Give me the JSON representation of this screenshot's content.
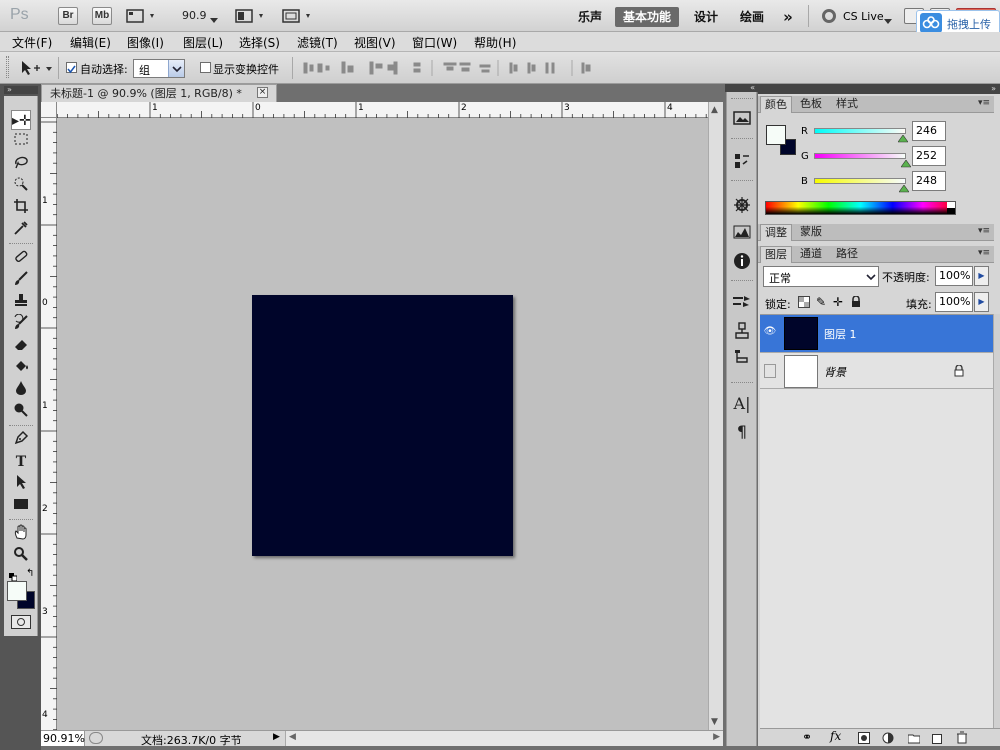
{
  "app": {
    "logo": "Ps",
    "bridge_btn": "Br",
    "minibridge_btn": "Mb",
    "zoom_value": "90.9",
    "workspaces": [
      "乐声",
      "基本功能",
      "设计",
      "绘画"
    ],
    "more": "»",
    "cs_live": "CS Live",
    "overlay_label": "拖拽上传"
  },
  "menubar": [
    "文件(F)",
    "编辑(E)",
    "图像(I)",
    "图层(L)",
    "选择(S)",
    "滤镜(T)",
    "视图(V)",
    "窗口(W)",
    "帮助(H)"
  ],
  "options": {
    "auto_select_label": "自动选择:",
    "auto_select_value": "组",
    "show_transform_label": "显示变换控件"
  },
  "document": {
    "tab_title": "未标题-1 @ 90.9% (图层 1, RGB/8) *",
    "close": "×",
    "ruler_h_labels": [
      "1",
      "0",
      "1",
      "2",
      "3",
      "4"
    ],
    "ruler_v_labels": [
      "1",
      "0",
      "1",
      "2",
      "3",
      "4"
    ],
    "zoom_status": "90.91%",
    "doc_info": "文档:263.7K/0 字节",
    "canvas_color": "#00052a"
  },
  "color_panel": {
    "tabs": [
      "颜色",
      "色板",
      "样式"
    ],
    "channels": [
      {
        "label": "R",
        "value": "246"
      },
      {
        "label": "G",
        "value": "252"
      },
      {
        "label": "B",
        "value": "248"
      }
    ],
    "foreground": "#f6fcf8",
    "background": "#00052a"
  },
  "adjust_panel": {
    "tabs": [
      "调整",
      "蒙版"
    ]
  },
  "layers_panel": {
    "tabs": [
      "图层",
      "通道",
      "路径"
    ],
    "blend_mode": "正常",
    "opacity_label": "不透明度:",
    "opacity_value": "100%",
    "lock_label": "锁定:",
    "fill_label": "填充:",
    "fill_value": "100%",
    "layers": [
      {
        "name": "图层 1",
        "selected": true,
        "visible": true,
        "thumb": "#00052a"
      },
      {
        "name": "背景",
        "selected": false,
        "visible": false,
        "thumb": "#ffffff"
      }
    ]
  },
  "colors": {
    "accent": "#3875d7"
  }
}
